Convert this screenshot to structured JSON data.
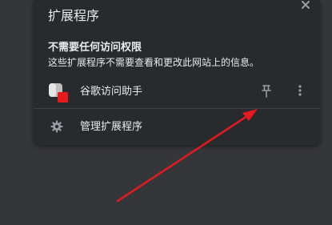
{
  "popup": {
    "title": "扩展程序",
    "close_icon": "close-icon"
  },
  "no_access_section": {
    "heading": "不需要任何访问权限",
    "description": "这些扩展程序不需要查看和更改此网站上的信息。"
  },
  "extensions": [
    {
      "name": "谷歌访问助手",
      "icon": "extension-icon",
      "pin_icon": "pin-icon",
      "more_icon": "more-vert-icon"
    }
  ],
  "manage": {
    "label": "管理扩展程序",
    "icon": "gear-icon"
  },
  "annotation": {
    "color": "#e8191f"
  },
  "colors": {
    "background": "#35363a",
    "popup": "#292a2d",
    "text": "#e8eaed",
    "icon": "#9aa0a6"
  }
}
